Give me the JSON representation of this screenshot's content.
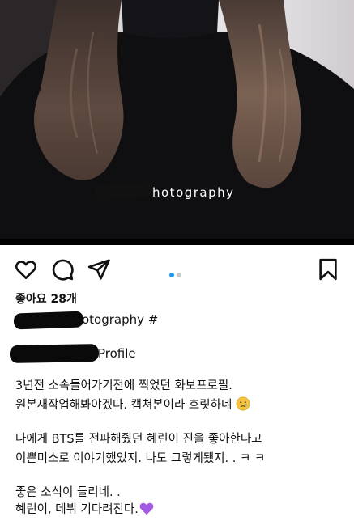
{
  "photo": {
    "watermark": "hotography"
  },
  "carousel": {
    "active_color": "#1d9bf0",
    "inactive_color": "#c8c8c8",
    "count": 2,
    "active_index": 0
  },
  "actions": {
    "like_icon": "heart-icon",
    "comment_icon": "comment-icon",
    "share_icon": "send-icon",
    "save_icon": "bookmark-icon"
  },
  "post": {
    "likes_text": "좋아요 28개",
    "account_suffix": "otography #",
    "profile_suffix": "Profile",
    "caption": [
      "3년전 소속들어가기전에 찍었던 화보프로필.",
      "원본재작업해봐야겠다. 캡쳐본이라 흐릿하네",
      "",
      "나에게 BTS를 전파해줬던 혜린이 진을 좋아한다고",
      "이쁜미소로 이야기했었지. 나도 그렇게됐지. . ㅋ ㅋ",
      "",
      "좋은 소식이 들리네. .",
      "혜린이, 데뷔 기다려진다."
    ],
    "caption_emoji_1": "sad-face-emoji",
    "caption_emoji_2": "purple-heart-emoji"
  }
}
